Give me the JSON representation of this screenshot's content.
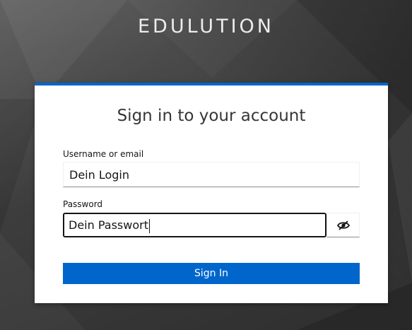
{
  "brand": {
    "name": "EDULUTION"
  },
  "login": {
    "title": "Sign in to your account",
    "username_label": "Username or email",
    "username_value": "Dein Login",
    "password_label": "Password",
    "password_value": "Dein Passwort",
    "toggle_icon": "eye-slash-icon",
    "submit_label": "Sign In"
  },
  "colors": {
    "accent": "#0066cc",
    "background": "#3d3d3d",
    "card": "#ffffff"
  }
}
